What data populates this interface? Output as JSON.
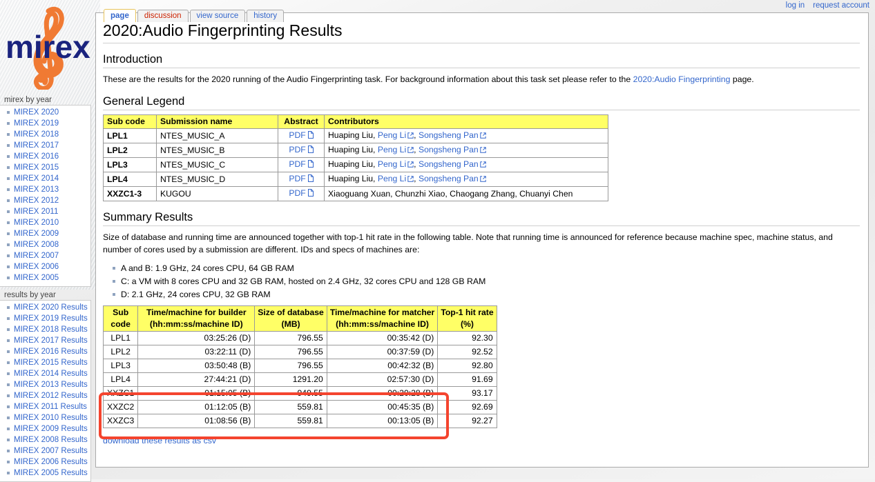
{
  "personal": {
    "login": "log in",
    "request_account": "request account"
  },
  "logo": {
    "text": "mirex",
    "navy": "#1a237e",
    "orange": "#f07a33",
    "clef_icon": "treble-clef-icon"
  },
  "tabs": [
    {
      "label": "page",
      "state": "selected"
    },
    {
      "label": "discussion",
      "state": "new"
    },
    {
      "label": "view source",
      "state": "normal"
    },
    {
      "label": "history",
      "state": "normal"
    }
  ],
  "sidebar": {
    "years": {
      "heading": "mirex by year",
      "items": [
        {
          "label": "MIREX 2020"
        },
        {
          "label": "MIREX 2019"
        },
        {
          "label": "MIREX 2018"
        },
        {
          "label": "MIREX 2017"
        },
        {
          "label": "MIREX 2016"
        },
        {
          "label": "MIREX 2015"
        },
        {
          "label": "MIREX 2014"
        },
        {
          "label": "MIREX 2013"
        },
        {
          "label": "MIREX 2012"
        },
        {
          "label": "MIREX 2011"
        },
        {
          "label": "MIREX 2010"
        },
        {
          "label": "MIREX 2009"
        },
        {
          "label": "MIREX 2008"
        },
        {
          "label": "MIREX 2007"
        },
        {
          "label": "MIREX 2006"
        },
        {
          "label": "MIREX 2005"
        }
      ]
    },
    "results": {
      "heading": "results by year",
      "items": [
        {
          "label": "MIREX 2020 Results"
        },
        {
          "label": "MIREX 2019 Results"
        },
        {
          "label": "MIREX 2018 Results"
        },
        {
          "label": "MIREX 2017 Results"
        },
        {
          "label": "MIREX 2016 Results"
        },
        {
          "label": "MIREX 2015 Results"
        },
        {
          "label": "MIREX 2014 Results"
        },
        {
          "label": "MIREX 2013 Results"
        },
        {
          "label": "MIREX 2012 Results"
        },
        {
          "label": "MIREX 2011 Results"
        },
        {
          "label": "MIREX 2010 Results"
        },
        {
          "label": "MIREX 2009 Results"
        },
        {
          "label": "MIREX 2008 Results"
        },
        {
          "label": "MIREX 2007 Results"
        },
        {
          "label": "MIREX 2006 Results"
        },
        {
          "label": "MIREX 2005 Results"
        }
      ]
    }
  },
  "page": {
    "title": "2020:Audio Fingerprinting Results",
    "sections": {
      "introduction": {
        "heading": "Introduction",
        "text_before_link": "These are the results for the 2020 running of the Audio Fingerprinting task. For background information about this task set please refer to the ",
        "link_label": "2020:Audio Fingerprinting",
        "text_after_link": " page."
      },
      "general_legend": {
        "heading": "General Legend",
        "columns": [
          "Sub code",
          "Submission name",
          "Abstract",
          "Contributors"
        ],
        "rows": [
          {
            "sub_code": "LPL1",
            "submission_name": "NTES_MUSIC_A",
            "abstract_label": "PDF",
            "contributors_plain": "Huaping Liu, ",
            "contributor_link_1": "Peng Li",
            "contributors_sep": ", ",
            "contributor_link_2": "Songsheng Pan"
          },
          {
            "sub_code": "LPL2",
            "submission_name": "NTES_MUSIC_B",
            "abstract_label": "PDF",
            "contributors_plain": "Huaping Liu, ",
            "contributor_link_1": "Peng Li",
            "contributors_sep": ", ",
            "contributor_link_2": "Songsheng Pan"
          },
          {
            "sub_code": "LPL3",
            "submission_name": "NTES_MUSIC_C",
            "abstract_label": "PDF",
            "contributors_plain": "Huaping Liu, ",
            "contributor_link_1": "Peng Li",
            "contributors_sep": ", ",
            "contributor_link_2": "Songsheng Pan"
          },
          {
            "sub_code": "LPL4",
            "submission_name": "NTES_MUSIC_D",
            "abstract_label": "PDF",
            "contributors_plain": "Huaping Liu, ",
            "contributor_link_1": "Peng Li",
            "contributors_sep": ", ",
            "contributor_link_2": "Songsheng Pan"
          },
          {
            "sub_code": "XXZC1-3",
            "submission_name": "KUGOU",
            "abstract_label": "PDF",
            "contributors_plain": "Xiaoguang Xuan, Chunzhi Xiao, Chaogang Zhang, Chuanyi Chen",
            "contributor_link_1": "",
            "contributors_sep": "",
            "contributor_link_2": ""
          }
        ]
      },
      "summary_results": {
        "heading": "Summary Results",
        "paragraph": "Size of database and running time are announced together with top-1 hit rate in the following table. Note that running time is announced for reference because machine spec, machine status, and number of cores used by a submission are different. IDs and specs of machines are:",
        "machine_specs": [
          "A and B: 1.9 GHz, 24 cores CPU, 64 GB RAM",
          "C: a VM with 8 cores CPU and 32 GB RAM, hosted on 2.4 GHz, 32 cores CPU and 128 GB RAM",
          "D: 2.1 GHz, 24 cores CPU, 32 GB RAM"
        ],
        "csv_link": "download these results as csv"
      }
    }
  },
  "chart_data": {
    "type": "table",
    "title": "Summary Results",
    "columns": [
      {
        "line1": "Sub",
        "line2": "code"
      },
      {
        "line1": "Time/machine for builder",
        "line2": "(hh:mm:ss/machine ID)"
      },
      {
        "line1": "Size of database",
        "line2": "(MB)"
      },
      {
        "line1": "Time/machine for matcher",
        "line2": "(hh:mm:ss/machine ID)"
      },
      {
        "line1": "Top-1 hit rate",
        "line2": "(%)"
      }
    ],
    "rows": [
      {
        "sub_code": "LPL1",
        "builder_time": "03:25:26 (D)",
        "db_size": "796.55",
        "matcher_time": "00:35:42 (D)",
        "hit_rate": "92.30",
        "highlighted": false
      },
      {
        "sub_code": "LPL2",
        "builder_time": "03:22:11 (D)",
        "db_size": "796.55",
        "matcher_time": "00:37:59 (D)",
        "hit_rate": "92.52",
        "highlighted": false
      },
      {
        "sub_code": "LPL3",
        "builder_time": "03:50:48 (B)",
        "db_size": "796.55",
        "matcher_time": "00:42:32 (B)",
        "hit_rate": "92.80",
        "highlighted": false
      },
      {
        "sub_code": "LPL4",
        "builder_time": "27:44:21 (D)",
        "db_size": "1291.20",
        "matcher_time": "02:57:30 (D)",
        "hit_rate": "91.69",
        "highlighted": false
      },
      {
        "sub_code": "XXZC1",
        "builder_time": "01:15:05 (B)",
        "db_size": "949.55",
        "matcher_time": "00:20:28 (B)",
        "hit_rate": "93.17",
        "highlighted": true
      },
      {
        "sub_code": "XXZC2",
        "builder_time": "01:12:05 (B)",
        "db_size": "559.81",
        "matcher_time": "00:45:35 (B)",
        "hit_rate": "92.69",
        "highlighted": true
      },
      {
        "sub_code": "XXZC3",
        "builder_time": "01:08:56 (B)",
        "db_size": "559.81",
        "matcher_time": "00:13:05 (B)",
        "hit_rate": "92.27",
        "highlighted": true
      }
    ],
    "highlight_color": "#f4442e",
    "header_color": "#ffff66"
  }
}
